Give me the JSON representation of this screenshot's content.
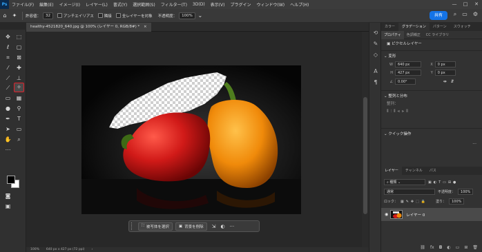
{
  "app": {
    "logo": "Ps"
  },
  "menu": [
    "ファイル(F)",
    "編集(E)",
    "イメージ(I)",
    "レイヤー(L)",
    "書式(Y)",
    "選択範囲(S)",
    "フィルター(T)",
    "3D(D)",
    "表示(V)",
    "プラグイン",
    "ウィンドウ(W)",
    "ヘルプ(H)"
  ],
  "window_controls": {
    "minimize": "—",
    "maximize": "□",
    "close": "✕"
  },
  "options": {
    "tolerance_label": "許容値：",
    "tolerance_value": "32",
    "antialias_label": "アンチエイリアス",
    "contiguous_label": "隣接",
    "all_layers_label": "全レイヤーを対象",
    "opacity_label": "不透明度：",
    "opacity_value": "100%",
    "share_label": "共有"
  },
  "document": {
    "tab_title": "healthy-4521820_640.jpg @ 100% (レイヤー 0, RGB/8#) *",
    "close": "×"
  },
  "context_bar": {
    "select_subject": "被写体を選択",
    "remove_bg": "背景を削除",
    "more": "···"
  },
  "status": {
    "zoom": "100%",
    "size": "640 px x 427 px (72 ppi)",
    "arrow": "›"
  },
  "panel": {
    "tabs": [
      "カラー",
      "グラデーション",
      "パターン",
      "スウォッチ"
    ],
    "subtabs": [
      "プロパティ",
      "色調補正",
      "CC ライブラリ"
    ],
    "pixel_layer": "ピクセルレイヤー",
    "transform_title": "変形",
    "w_label": "W",
    "w_value": "640 px",
    "h_label": "H",
    "h_value": "427 px",
    "x_label": "X",
    "x_value": "0 px",
    "y_label": "Y",
    "y_value": "0 px",
    "angle_value": "0.00°",
    "align_title": "整列と分布",
    "align_label": "整列：",
    "quick_actions": "クイック操作"
  },
  "layers": {
    "tabs": [
      "レイヤー",
      "チャンネル",
      "パス"
    ],
    "kind": "種類",
    "blend": "通常",
    "opacity_label": "不透明度：",
    "opacity_value": "100%",
    "lock_label": "ロック：",
    "fill_label": "塗り：",
    "fill_value": "100%",
    "layer_name": "レイヤー 0"
  }
}
